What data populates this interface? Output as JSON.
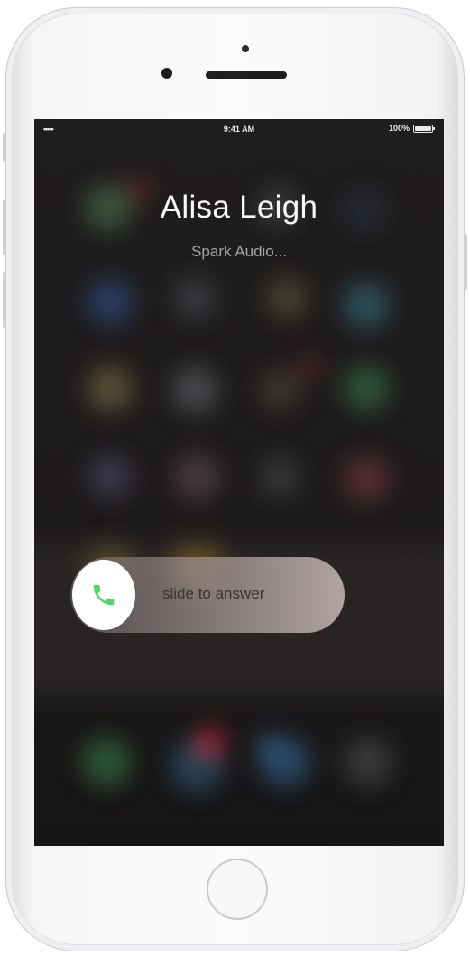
{
  "status_bar": {
    "signal": "•••••",
    "time": "9:41 AM",
    "battery": "100%",
    "battery_level": 1.0
  },
  "call": {
    "caller_name": "Alisa Leigh",
    "caller_subtitle": "Spark Audio..."
  },
  "slider": {
    "label": "slide to answer",
    "knob_icon": "phone-icon"
  },
  "colors": {
    "accept_green": "#4cd964",
    "screen_background": "#1c1a1b"
  }
}
